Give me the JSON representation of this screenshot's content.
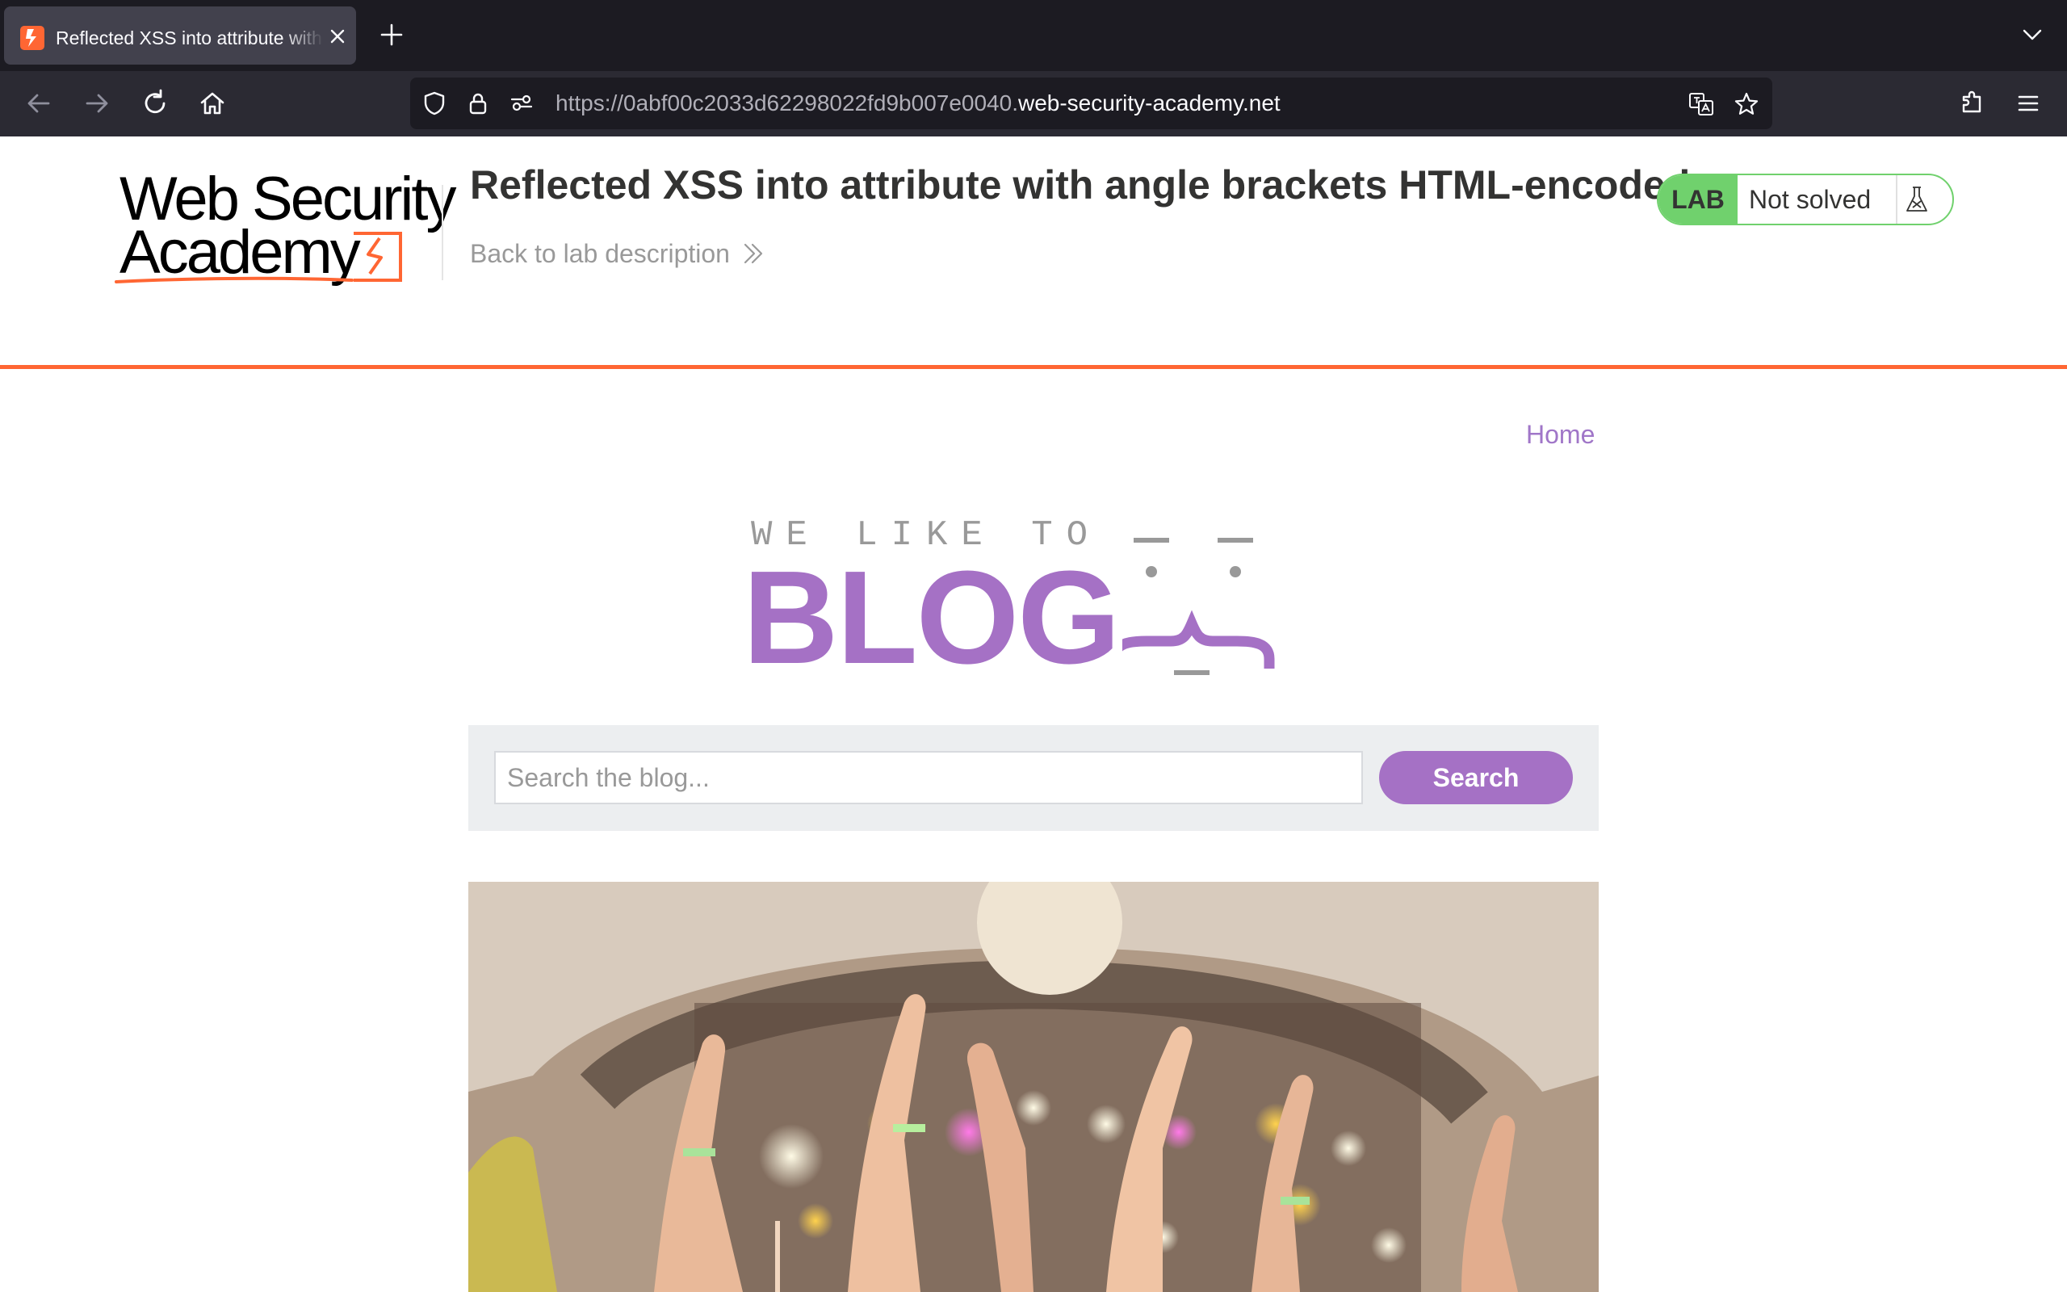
{
  "browser": {
    "tab_title": "Reflected XSS into attribute with angle brackets HTML-encoded",
    "url_prefix": "https://0abf00c2033d62298022fd9b007e0040.",
    "url_host": "web-security-academy.net"
  },
  "lab_header": {
    "logo_line1": "Web Security",
    "logo_line2": "Academy",
    "title": "Reflected XSS into attribute with angle brackets HTML-encoded",
    "back_link": "Back to lab description",
    "badge": "LAB",
    "status": "Not solved"
  },
  "nav": {
    "home": "Home"
  },
  "blog_logo": {
    "tagline": "WE LIKE TO",
    "word": "BLOG"
  },
  "search": {
    "placeholder": "Search the blog...",
    "value": "",
    "button": "Search"
  },
  "colors": {
    "brand_orange": "#ff6633",
    "blog_purple": "#a571c5",
    "lab_green": "#70d16d",
    "link_purple": "#a076c8"
  },
  "icons": [
    "back-arrow-icon",
    "forward-arrow-icon",
    "reload-icon",
    "home-icon",
    "shield-icon",
    "lock-icon",
    "permissions-icon",
    "translate-icon",
    "star-icon",
    "extensions-icon",
    "menu-icon",
    "flask-icon",
    "chevron-double-right-icon",
    "close-icon",
    "plus-icon",
    "chevron-down-icon"
  ]
}
